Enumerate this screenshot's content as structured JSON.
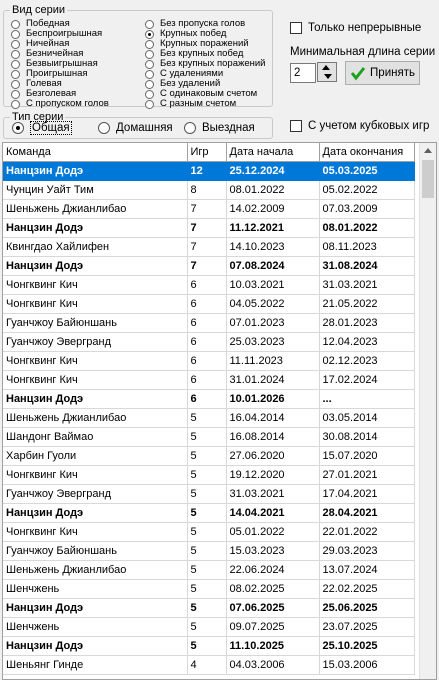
{
  "series_view": {
    "title": "Вид серии",
    "left_options": [
      "Победная",
      "Беспроигрышная",
      "Ничейная",
      "Безничейная",
      "Безвыигрышная",
      "Проигрышная",
      "Голевая",
      "Безголевая",
      "С пропуском голов"
    ],
    "right_options": [
      "Без пропуска голов",
      "Крупных побед",
      "Крупных поражений",
      "Без крупных побед",
      "Без крупных поражений",
      "С удалениями",
      "Без удалений",
      "С одинаковым счетом",
      "С разным счетом"
    ],
    "selected": "Крупных побед"
  },
  "series_type": {
    "title": "Тип серии",
    "options": [
      "Общая",
      "Домашняя",
      "Выездная"
    ],
    "selected": "Общая"
  },
  "non_continuous_label": "Только непрерывные",
  "min_length_label": "Минимальная длина серии",
  "min_length_value": "2",
  "accept_label": "Принять",
  "cup_games_label": "С учетом кубковых игр",
  "table": {
    "columns": [
      "Команда",
      "Игр",
      "Дата начала",
      "Дата окончания"
    ],
    "rows": [
      {
        "team": "Нанцзин Додэ",
        "games": "12",
        "start": "25.12.2024",
        "end": "05.03.2025",
        "bold": true,
        "selected": true
      },
      {
        "team": "Чунцин Уайт Тим",
        "games": "8",
        "start": "08.01.2022",
        "end": "05.02.2022",
        "bold": false,
        "selected": false
      },
      {
        "team": "Шеньжень Джианлибао",
        "games": "7",
        "start": "14.02.2009",
        "end": "07.03.2009",
        "bold": false,
        "selected": false
      },
      {
        "team": "Нанцзин Додэ",
        "games": "7",
        "start": "11.12.2021",
        "end": "08.01.2022",
        "bold": true,
        "selected": false
      },
      {
        "team": "Квингдао Хайлифен",
        "games": "7",
        "start": "14.10.2023",
        "end": "08.11.2023",
        "bold": false,
        "selected": false
      },
      {
        "team": "Нанцзин Додэ",
        "games": "7",
        "start": "07.08.2024",
        "end": "31.08.2024",
        "bold": true,
        "selected": false
      },
      {
        "team": "Чонгквинг Кич",
        "games": "6",
        "start": "10.03.2021",
        "end": "31.03.2021",
        "bold": false,
        "selected": false
      },
      {
        "team": "Чонгквинг Кич",
        "games": "6",
        "start": "04.05.2022",
        "end": "21.05.2022",
        "bold": false,
        "selected": false
      },
      {
        "team": "Гуанчжоу Байюншань",
        "games": "6",
        "start": "07.01.2023",
        "end": "28.01.2023",
        "bold": false,
        "selected": false
      },
      {
        "team": "Гуанчжоу Эвергранд",
        "games": "6",
        "start": "25.03.2023",
        "end": "12.04.2023",
        "bold": false,
        "selected": false
      },
      {
        "team": "Чонгквинг Кич",
        "games": "6",
        "start": "11.11.2023",
        "end": "02.12.2023",
        "bold": false,
        "selected": false
      },
      {
        "team": "Чонгквинг Кич",
        "games": "6",
        "start": "31.01.2024",
        "end": "17.02.2024",
        "bold": false,
        "selected": false
      },
      {
        "team": "Нанцзин Додэ",
        "games": "6",
        "start": "10.01.2026",
        "end": "...",
        "bold": true,
        "selected": false
      },
      {
        "team": "Шеньжень Джианлибао",
        "games": "5",
        "start": "16.04.2014",
        "end": "03.05.2014",
        "bold": false,
        "selected": false
      },
      {
        "team": "Шандонг Ваймао",
        "games": "5",
        "start": "16.08.2014",
        "end": "30.08.2014",
        "bold": false,
        "selected": false
      },
      {
        "team": "Харбин Гуоли",
        "games": "5",
        "start": "27.06.2020",
        "end": "15.07.2020",
        "bold": false,
        "selected": false
      },
      {
        "team": "Чонгквинг Кич",
        "games": "5",
        "start": "19.12.2020",
        "end": "27.01.2021",
        "bold": false,
        "selected": false
      },
      {
        "team": "Гуанчжоу Эвергранд",
        "games": "5",
        "start": "31.03.2021",
        "end": "17.04.2021",
        "bold": false,
        "selected": false
      },
      {
        "team": "Нанцзин Додэ",
        "games": "5",
        "start": "14.04.2021",
        "end": "28.04.2021",
        "bold": true,
        "selected": false
      },
      {
        "team": "Чонгквинг Кич",
        "games": "5",
        "start": "05.01.2022",
        "end": "22.01.2022",
        "bold": false,
        "selected": false
      },
      {
        "team": "Гуанчжоу Байюншань",
        "games": "5",
        "start": "15.03.2023",
        "end": "29.03.2023",
        "bold": false,
        "selected": false
      },
      {
        "team": "Шеньжень Джианлибао",
        "games": "5",
        "start": "22.06.2024",
        "end": "13.07.2024",
        "bold": false,
        "selected": false
      },
      {
        "team": "Шенчжень",
        "games": "5",
        "start": "08.02.2025",
        "end": "22.02.2025",
        "bold": false,
        "selected": false
      },
      {
        "team": "Нанцзин Додэ",
        "games": "5",
        "start": "07.06.2025",
        "end": "25.06.2025",
        "bold": true,
        "selected": false
      },
      {
        "team": "Шенчжень",
        "games": "5",
        "start": "09.07.2025",
        "end": "23.07.2025",
        "bold": false,
        "selected": false
      },
      {
        "team": "Нанцзин Додэ",
        "games": "5",
        "start": "11.10.2025",
        "end": "25.10.2025",
        "bold": true,
        "selected": false
      },
      {
        "team": "Шеньянг Гинде",
        "games": "4",
        "start": "04.03.2006",
        "end": "15.03.2006",
        "bold": false,
        "selected": false
      }
    ]
  },
  "colors": {
    "selection": "#0078d7",
    "accept_check": "#1aa11a"
  }
}
